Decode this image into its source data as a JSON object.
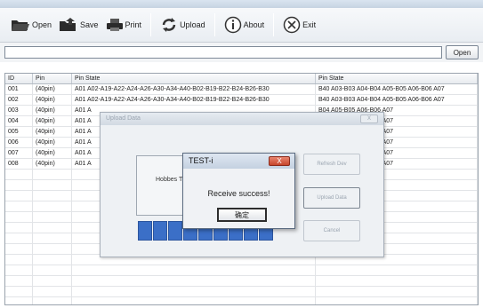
{
  "toolbar": {
    "items": [
      {
        "label": "Open",
        "icon": "folder-open-icon"
      },
      {
        "label": "Save",
        "icon": "folder-save-icon"
      },
      {
        "label": "Print",
        "icon": "printer-icon"
      },
      {
        "label": "Upload",
        "icon": "refresh-upload-icon"
      },
      {
        "label": "About",
        "icon": "info-icon"
      },
      {
        "label": "Exit",
        "icon": "close-circle-icon"
      }
    ]
  },
  "path": {
    "value": "",
    "open_label": "Open"
  },
  "grid": {
    "headers": [
      "ID",
      "Pin",
      "Pin State",
      "Pin State"
    ],
    "rows": [
      [
        "001",
        "(40pin)",
        "A01  A02-A19-A22-A24-A26-A30-A34-A40-B02-B19-B22-B24-B26-B30",
        "B40  A03-B03  A04-B04  A05-B05  A06-B06  A07"
      ],
      [
        "002",
        "(40pin)",
        "A01  A02-A19-A22-A24-A26-A30-A34-A40-B02-B19-B22-B24-B26-B30",
        "B40  A03-B03  A04-B04  A05-B05  A06-B06  A07"
      ],
      [
        "003",
        "(40pin)",
        "A01  A",
        "B04  A05-B05  A06-B06  A07"
      ],
      [
        "004",
        "(40pin)",
        "A01  A",
        "B04  A05-B05  A06-B06  A07"
      ],
      [
        "005",
        "(40pin)",
        "A01  A",
        "B04  A05-B05  A06-B06  A07"
      ],
      [
        "006",
        "(40pin)",
        "A01  A",
        "B04  A05-B05  A06-B06  A07"
      ],
      [
        "007",
        "(40pin)",
        "A01  A",
        "B04  A05-B05  A06-B06  A07"
      ],
      [
        "008",
        "(40pin)",
        "A01  A",
        "B04  A05-B05  A06-B06  A07"
      ]
    ]
  },
  "upload_dialog": {
    "title": "Upload Data",
    "close_label": "X",
    "device_label": "Hobbes TE",
    "refresh_label": "Refresh Dev",
    "upload_label": "Upload Data",
    "cancel_label": "Cancel",
    "progress_blocks": 9
  },
  "message_box": {
    "title": "TEST-i",
    "close_label": "X",
    "text": "Receive   success!",
    "ok_label": "确定"
  }
}
